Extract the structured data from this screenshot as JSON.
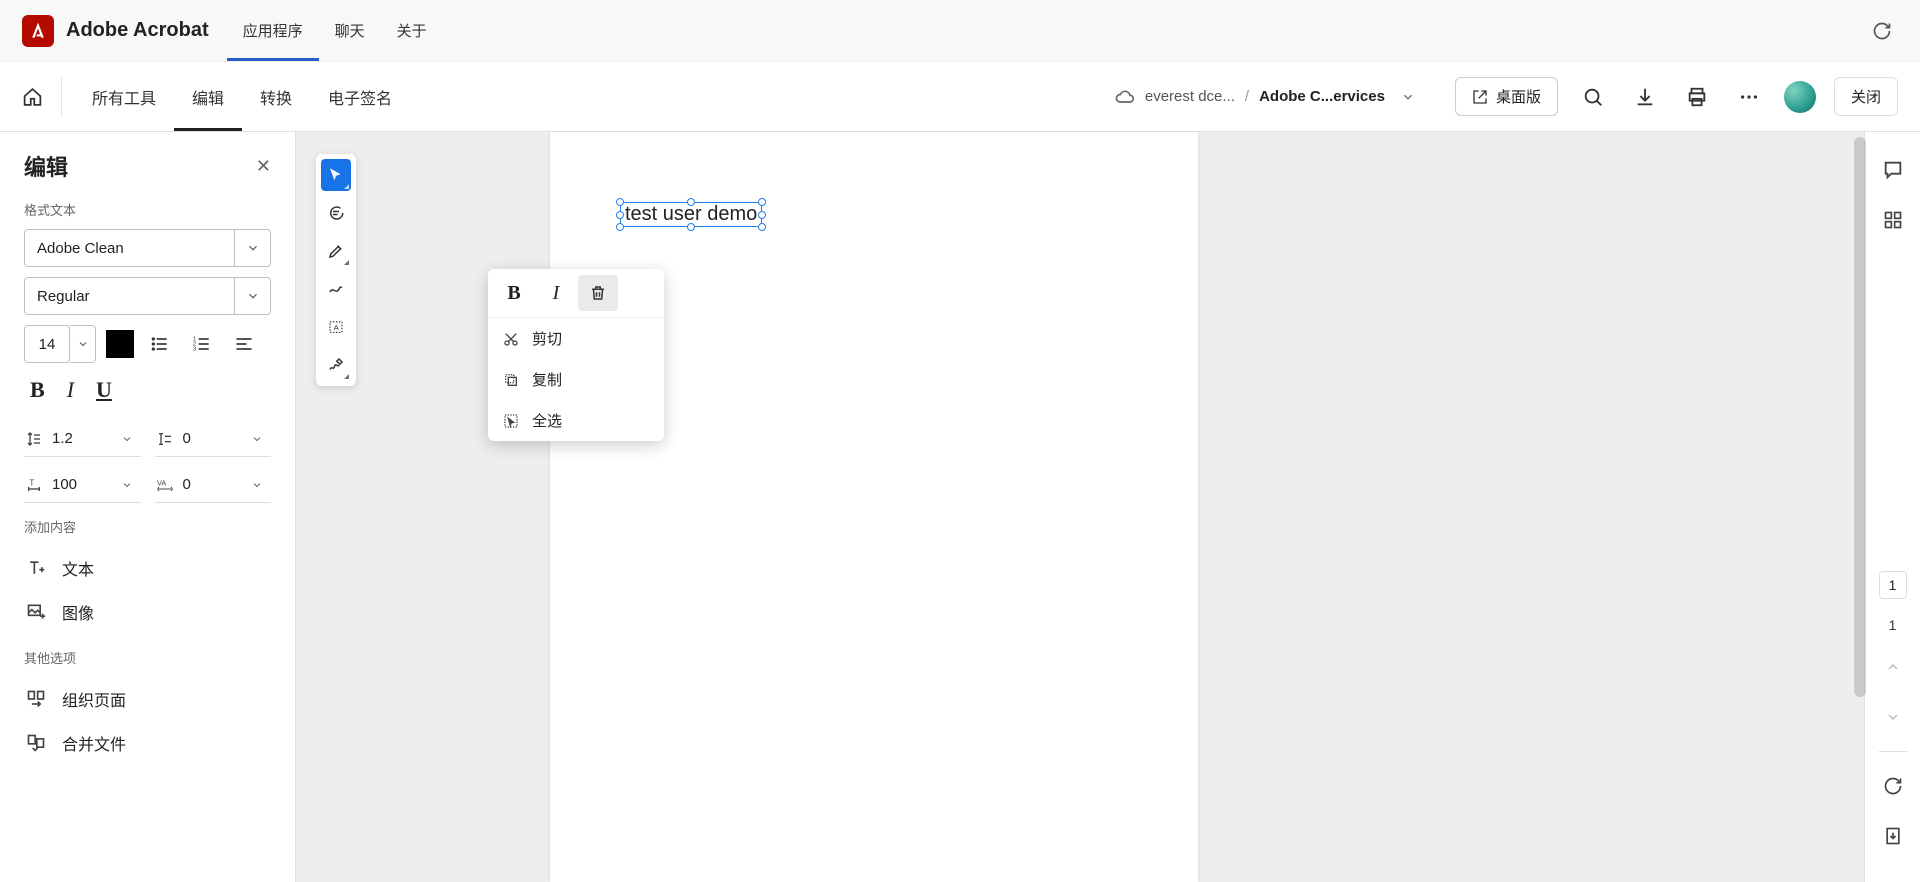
{
  "header": {
    "app_title": "Adobe Acrobat",
    "tabs": [
      "应用程序",
      "聊天",
      "关于"
    ],
    "active_tab": 0
  },
  "subbar": {
    "tabs": [
      "所有工具",
      "编辑",
      "转换",
      "电子签名"
    ],
    "active_tab": 1,
    "breadcrumb_cloud": "everest dce...",
    "breadcrumb_current": "Adobe C...ervices",
    "desktop_btn": "桌面版",
    "close_btn": "关闭"
  },
  "edit_panel": {
    "title": "编辑",
    "section_format": "格式文本",
    "font_family": "Adobe Clean",
    "font_weight": "Regular",
    "font_size": "14",
    "line_height": "1.2",
    "para_spacing": "0",
    "char_spacing": "100",
    "kerning": "0",
    "section_add": "添加内容",
    "add_text": "文本",
    "add_image": "图像",
    "section_other": "其他选项",
    "organize": "组织页面",
    "combine": "合并文件"
  },
  "canvas": {
    "text_content": "test user demo"
  },
  "context_menu": {
    "bold": "B",
    "italic": "I",
    "cut": "剪切",
    "copy": "复制",
    "select_all": "全选"
  },
  "right_rail": {
    "page_current": "1",
    "page_total": "1"
  }
}
